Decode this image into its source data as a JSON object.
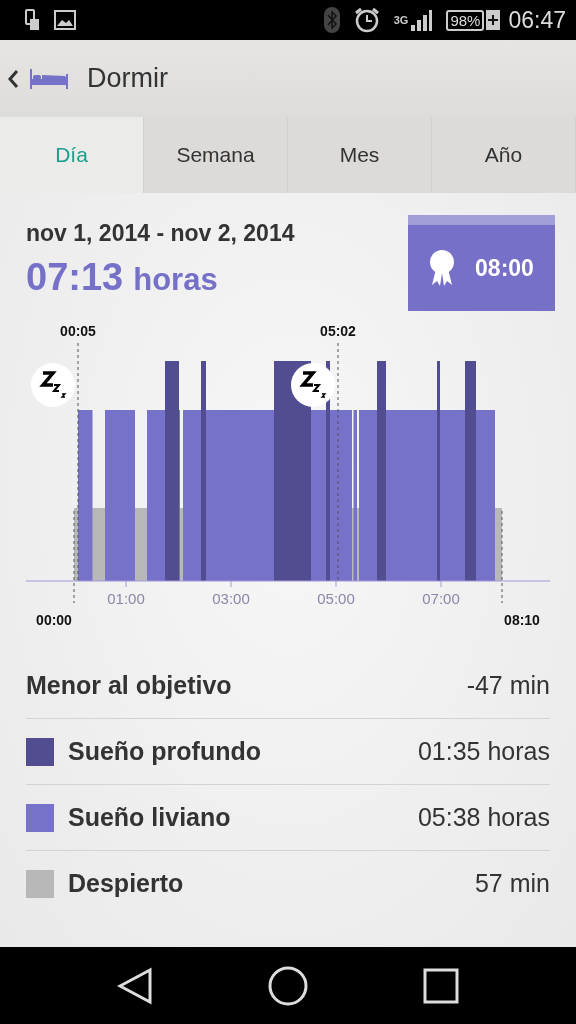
{
  "status_bar": {
    "network": "3G",
    "battery": "98%",
    "time": "06:47"
  },
  "header": {
    "title": "Dormir"
  },
  "tabs": [
    {
      "label": "Día",
      "selected": true
    },
    {
      "label": "Semana",
      "selected": false
    },
    {
      "label": "Mes",
      "selected": false
    },
    {
      "label": "Año",
      "selected": false
    }
  ],
  "summary": {
    "date_range": "nov 1, 2014 - nov 2, 2014",
    "duration_value": "07:13",
    "duration_unit": "horas",
    "goal": "08:00"
  },
  "hypnogram": {
    "markers": [
      "00:05",
      "05:02"
    ],
    "axis_labels": [
      "01:00",
      "03:00",
      "05:00",
      "07:00"
    ],
    "start_label": "00:00",
    "end_label": "08:10"
  },
  "stats": [
    {
      "kind": "goal",
      "label": "Menor al objetivo",
      "value": "-47 min"
    },
    {
      "kind": "legend",
      "label": "Sueño profundo",
      "value": "01:35 horas",
      "color": "#524d91"
    },
    {
      "kind": "legend",
      "label": "Sueño liviano",
      "value": "05:38 horas",
      "color": "#7772c9"
    },
    {
      "kind": "legend",
      "label": "Despierto",
      "value": "57 min",
      "color": "#b8b8b8"
    }
  ]
}
